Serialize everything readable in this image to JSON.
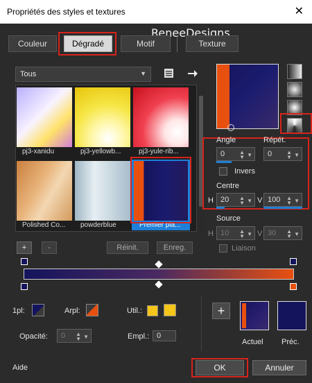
{
  "window": {
    "title": "Propriétés des styles et textures",
    "close_glyph": "✕"
  },
  "watermark": "ReneeDesigns",
  "tabs": [
    {
      "label": "Couleur"
    },
    {
      "label": "Dégradé"
    },
    {
      "label": "Motif"
    },
    {
      "label": "Texture"
    }
  ],
  "category": {
    "selected": "Tous"
  },
  "thumbnails": [
    {
      "caption": "pj3-xanidu"
    },
    {
      "caption": "pj3-yellowb..."
    },
    {
      "caption": "pj3-yule-rib..."
    },
    {
      "caption": "Polished Co..."
    },
    {
      "caption": "powderblue"
    },
    {
      "caption": "Premier pla..."
    }
  ],
  "list_buttons": {
    "add": "+",
    "remove": "-",
    "reset": "Réinit.",
    "save": "Enreg."
  },
  "angle": {
    "label": "Angle",
    "value": "0"
  },
  "repeat": {
    "label": "Répét.",
    "value": "0"
  },
  "invert": {
    "label": "Invers"
  },
  "center": {
    "label": "Centre",
    "h_label": "H",
    "h_value": "20",
    "v_label": "V",
    "v_value": "100"
  },
  "source": {
    "label": "Source",
    "h_label": "H",
    "h_value": "10",
    "v_label": "V",
    "v_value": "30"
  },
  "link": {
    "label": "Liaison"
  },
  "stops": {
    "first_label": "1pl:",
    "back_label": "Arpl:",
    "user_label": "Util.:",
    "opacity_label": "Opacité:",
    "opacity_value": "0",
    "position_label": "Empl.:",
    "position_value": "0"
  },
  "preview": {
    "add": "+",
    "current_label": "Actuel",
    "previous_label": "Préc."
  },
  "footer": {
    "help": "Aide",
    "ok": "OK",
    "cancel": "Annuler"
  },
  "colors": {
    "navy": "#14145c",
    "orange": "#e8500f",
    "yellow": "#f5c518",
    "highlight_red": "#d6241b",
    "selection_blue": "#1e7fd8"
  }
}
